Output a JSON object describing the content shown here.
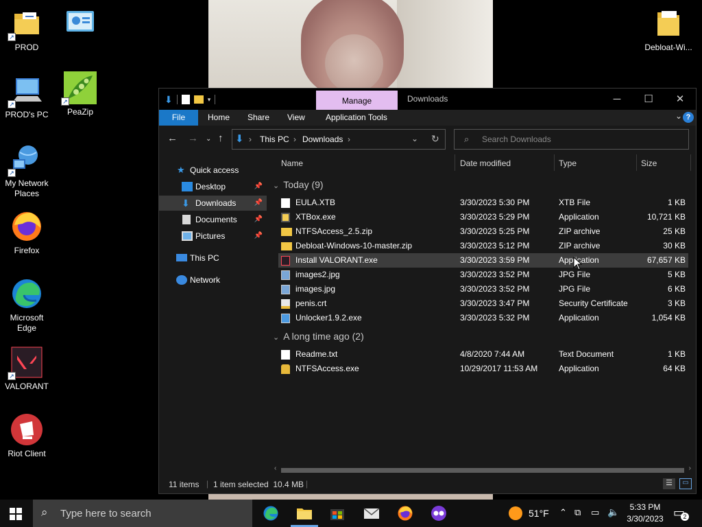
{
  "desktop": {
    "icons": [
      {
        "label": "PROD",
        "icon": "folder-icon"
      },
      {
        "label": "",
        "icon": "control-panel-icon"
      },
      {
        "label": "PROD's PC",
        "icon": "computer-icon"
      },
      {
        "label": "PeaZip",
        "icon": "peazip-icon"
      },
      {
        "label": "My Network Places",
        "icon": "network-globe-icon"
      },
      {
        "label": "Firefox",
        "icon": "firefox-icon"
      },
      {
        "label": "Microsoft Edge",
        "icon": "edge-icon"
      },
      {
        "label": "VALORANT",
        "icon": "valorant-icon"
      },
      {
        "label": "Riot Client",
        "icon": "riot-client-icon"
      },
      {
        "label": "Debloat-Wi...",
        "icon": "folder-icon"
      }
    ]
  },
  "window": {
    "title": "Downloads",
    "context_tab": "Manage",
    "ribbon_tabs": [
      "File",
      "Home",
      "Share",
      "View",
      "Application Tools"
    ],
    "address": [
      "This PC",
      "Downloads"
    ],
    "search_placeholder": "Search Downloads",
    "nav": {
      "quick_access": "Quick access",
      "pinned": [
        "Desktop",
        "Downloads",
        "Documents",
        "Pictures"
      ],
      "this_pc": "This PC",
      "network": "Network"
    },
    "columns": [
      "Name",
      "Date modified",
      "Type",
      "Size"
    ],
    "groups": [
      {
        "label": "Today (9)",
        "files": [
          {
            "name": "EULA.XTB",
            "date": "3/30/2023 5:30 PM",
            "type": "XTB File",
            "size": "1 KB",
            "icon": "document-icon"
          },
          {
            "name": "XTBox.exe",
            "date": "3/30/2023 5:29 PM",
            "type": "Application",
            "size": "10,721 KB",
            "icon": "app-icon"
          },
          {
            "name": "NTFSAccess_2.5.zip",
            "date": "3/30/2023 5:25 PM",
            "type": "ZIP archive",
            "size": "25 KB",
            "icon": "zip-folder-icon"
          },
          {
            "name": "Debloat-Windows-10-master.zip",
            "date": "3/30/2023 5:12 PM",
            "type": "ZIP archive",
            "size": "30 KB",
            "icon": "zip-folder-icon"
          },
          {
            "name": "Install VALORANT.exe",
            "date": "3/30/2023 3:59 PM",
            "type": "Application",
            "size": "67,657 KB",
            "icon": "valorant-icon",
            "selected": true
          },
          {
            "name": "images2.jpg",
            "date": "3/30/2023 3:52 PM",
            "type": "JPG File",
            "size": "5 KB",
            "icon": "image-icon"
          },
          {
            "name": "images.jpg",
            "date": "3/30/2023 3:52 PM",
            "type": "JPG File",
            "size": "6 KB",
            "icon": "image-icon"
          },
          {
            "name": "penis.crt",
            "date": "3/30/2023 3:47 PM",
            "type": "Security Certificate",
            "size": "3 KB",
            "icon": "certificate-icon"
          },
          {
            "name": "Unlocker1.9.2.exe",
            "date": "3/30/2023 5:32 PM",
            "type": "Application",
            "size": "1,054 KB",
            "icon": "app-icon"
          }
        ]
      },
      {
        "label": "A long time ago (2)",
        "files": [
          {
            "name": "Readme.txt",
            "date": "4/8/2020 7:44 AM",
            "type": "Text Document",
            "size": "1 KB",
            "icon": "text-file-icon"
          },
          {
            "name": "NTFSAccess.exe",
            "date": "10/29/2017 11:53 AM",
            "type": "Application",
            "size": "64 KB",
            "icon": "lock-app-icon"
          }
        ]
      }
    ],
    "status": {
      "items": "11 items",
      "selected": "1 item selected  10.4 MB"
    }
  },
  "taskbar": {
    "search_placeholder": "Type here to search",
    "weather": "51°F",
    "time": "5:33 PM",
    "date": "3/30/2023",
    "notifications": "2"
  },
  "colors": {
    "accent": "#1a78c8",
    "manage_tab": "#e3bdf0",
    "folder": "#f2c744"
  }
}
